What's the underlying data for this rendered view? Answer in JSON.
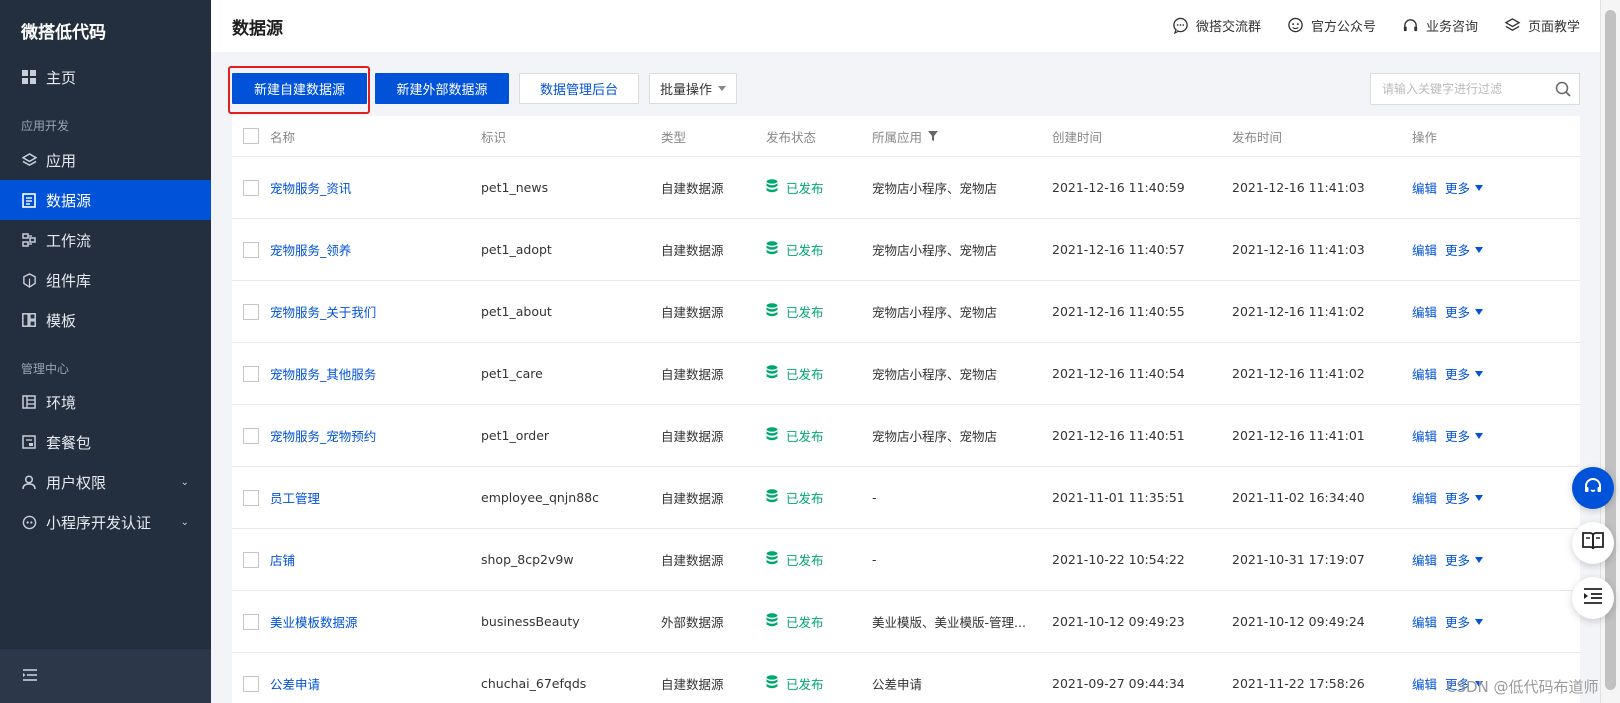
{
  "sidebar": {
    "brand": "微搭低代码",
    "items": [
      {
        "label": "主页",
        "icon": "grid-icon",
        "active": false
      },
      {
        "label": "应用",
        "icon": "layers-icon",
        "active": false
      },
      {
        "label": "数据源",
        "icon": "document-icon",
        "active": true
      },
      {
        "label": "工作流",
        "icon": "workflow-icon",
        "active": false
      },
      {
        "label": "组件库",
        "icon": "component-icon",
        "active": false
      },
      {
        "label": "模板",
        "icon": "template-icon",
        "active": false
      },
      {
        "label": "环境",
        "icon": "environment-icon",
        "active": false
      },
      {
        "label": "套餐包",
        "icon": "package-icon",
        "active": false
      },
      {
        "label": "用户权限",
        "icon": "user-icon",
        "active": false
      },
      {
        "label": "小程序开发认证",
        "icon": "miniprogram-icon",
        "active": false
      }
    ],
    "sections": {
      "dev": "应用开发",
      "manage": "管理中心"
    }
  },
  "header": {
    "title": "数据源",
    "links": [
      {
        "label": "微搭交流群",
        "icon": "chat-icon"
      },
      {
        "label": "官方公众号",
        "icon": "wechat-icon"
      },
      {
        "label": "业务咨询",
        "icon": "headset-icon"
      },
      {
        "label": "页面教学",
        "icon": "stack-icon"
      }
    ]
  },
  "toolbar": {
    "new_internal": "新建自建数据源",
    "new_external": "新建外部数据源",
    "admin": "数据管理后台",
    "batch": "批量操作",
    "search_placeholder": "请输入关键字进行过滤"
  },
  "table": {
    "columns": [
      "名称",
      "标识",
      "类型",
      "发布状态",
      "所属应用",
      "创建时间",
      "发布时间",
      "操作"
    ],
    "edit_label": "编辑",
    "more_label": "更多",
    "rows": [
      {
        "name": "宠物服务_资讯",
        "id": "pet1_news",
        "type": "自建数据源",
        "status": "已发布",
        "app": "宠物店小程序、宠物店",
        "created": "2021-12-16 11:40:59",
        "published": "2021-12-16 11:41:03"
      },
      {
        "name": "宠物服务_领养",
        "id": "pet1_adopt",
        "type": "自建数据源",
        "status": "已发布",
        "app": "宠物店小程序、宠物店",
        "created": "2021-12-16 11:40:57",
        "published": "2021-12-16 11:41:03"
      },
      {
        "name": "宠物服务_关于我们",
        "id": "pet1_about",
        "type": "自建数据源",
        "status": "已发布",
        "app": "宠物店小程序、宠物店",
        "created": "2021-12-16 11:40:55",
        "published": "2021-12-16 11:41:02"
      },
      {
        "name": "宠物服务_其他服务",
        "id": "pet1_care",
        "type": "自建数据源",
        "status": "已发布",
        "app": "宠物店小程序、宠物店",
        "created": "2021-12-16 11:40:54",
        "published": "2021-12-16 11:41:02"
      },
      {
        "name": "宠物服务_宠物预约",
        "id": "pet1_order",
        "type": "自建数据源",
        "status": "已发布",
        "app": "宠物店小程序、宠物店",
        "created": "2021-12-16 11:40:51",
        "published": "2021-12-16 11:41:01"
      },
      {
        "name": "员工管理",
        "id": "employee_qnjn88c",
        "type": "自建数据源",
        "status": "已发布",
        "app": "-",
        "created": "2021-11-01 11:35:51",
        "published": "2021-11-02 16:34:40"
      },
      {
        "name": "店铺",
        "id": "shop_8cp2v9w",
        "type": "自建数据源",
        "status": "已发布",
        "app": "-",
        "created": "2021-10-22 10:54:22",
        "published": "2021-10-31 17:19:07"
      },
      {
        "name": "美业模板数据源",
        "id": "businessBeauty",
        "type": "外部数据源",
        "status": "已发布",
        "app": "美业模版、美业模版-管理...",
        "created": "2021-10-12 09:49:23",
        "published": "2021-10-12 09:49:24"
      },
      {
        "name": "公差申请",
        "id": "chuchai_67efqds",
        "type": "自建数据源",
        "status": "已发布",
        "app": "公差申请",
        "created": "2021-09-27 09:44:34",
        "published": "2021-11-22 17:58:26"
      }
    ]
  },
  "watermark": "CSDN @低代码布道师",
  "colors": {
    "primary": "#0052d9",
    "sidebar_bg": "#232f3e",
    "success": "#00a870",
    "highlight": "#e41e1e"
  }
}
